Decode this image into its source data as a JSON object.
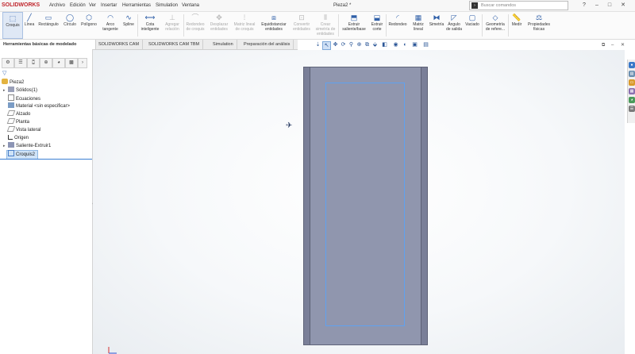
{
  "app": {
    "logo_text": "SOLIDWORKS"
  },
  "menu": [
    "Archivo",
    "Edición",
    "Ver",
    "Insertar",
    "Herramientas",
    "Simulation",
    "Ventana"
  ],
  "document_title": "Pieza2 *",
  "search": {
    "placeholder": "Buscar comandos"
  },
  "window_buttons": [
    "?",
    "–",
    "□",
    "✕"
  ],
  "ribbon": {
    "croquis": "Croquis",
    "linea": "Línea",
    "rectangulo": "Rectángulo",
    "circulo": "Círculo",
    "poligono": "Polígono",
    "arco_tangente": "Arco tangente",
    "spline": "Spline",
    "cota_inteligente": "Cota inteligente",
    "agregar_relacion": "Agregar relación",
    "redondeo_croquis": "Redondeo de croquis",
    "desplazar_entidades": "Desplazar entidades",
    "matriz_lineal_croquis": "Matriz lineal de croquis",
    "equidistanciar_entidades": "Equidistanciar entidades",
    "convertir_entidades": "Convertir entidades",
    "crear_simetria": "Crear simetría de entidades",
    "extruir_saliente": "Extruir saliente/base",
    "extruir_corte": "Extruir corte",
    "redondeo": "Redondeo",
    "matriz_lineal": "Matriz lineal",
    "simetria": "Simetría",
    "angulo_salida": "Ángulo de salida",
    "vaciado": "Vaciado",
    "geometria_referencia": "Geometría de refere...",
    "medir": "Medir",
    "propiedades_fisicas": "Propiedades físicas"
  },
  "tabs": [
    "Herramientas básicas de modelado",
    "SOLIDWORKS CAM",
    "SOLIDWORKS CAM TBM",
    "Simulation",
    "Preparación del análisis"
  ],
  "tree": {
    "root": "Pieza2",
    "solidos": "Sólidos(1)",
    "ecuaciones": "Ecuaciones",
    "material": "Material <sin especificar>",
    "alzado": "Alzado",
    "planta": "Planta",
    "vista_lateral": "Vista lateral",
    "origen": "Origen",
    "saliente": "Saliente-Extruir1",
    "croquis": "Croquis2"
  },
  "colors": {
    "accent": "#2f5fa8",
    "sketch_line": "#5fa1f0",
    "part_face": "#9096ae",
    "selection": "#cfe3f7"
  },
  "icons": {
    "search": "search-icon",
    "filter": "filter-icon",
    "part": "part-icon",
    "folder": "folder-icon",
    "plane": "plane-icon",
    "origin": "origin-icon",
    "sketch": "sketch-icon"
  }
}
